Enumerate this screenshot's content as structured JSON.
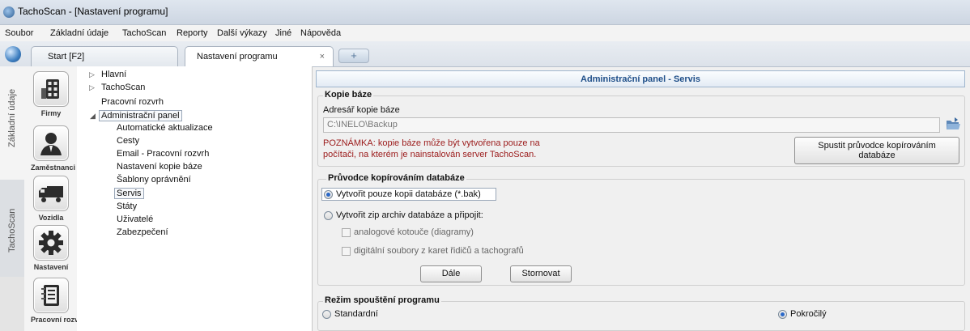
{
  "window": {
    "title": "TachoScan - [Nastavení programu]"
  },
  "menu": [
    "Soubor",
    "Základní údaje",
    "TachoScan",
    "Reporty",
    "Další výkazy",
    "Jiné",
    "Nápověda"
  ],
  "tabs": [
    {
      "label": "Start [F2]"
    },
    {
      "label": "Nastavení programu",
      "close": "×"
    }
  ],
  "new_tab": "+",
  "side_tabs": [
    "Základní údaje",
    "TachoScan"
  ],
  "icon_buttons": [
    {
      "label": "Firmy",
      "icon": "building-icon"
    },
    {
      "label": "Zaměstnanci",
      "icon": "employee-icon"
    },
    {
      "label": "Vozidla",
      "icon": "truck-icon"
    },
    {
      "label": "Nastavení",
      "icon": "gear-icon"
    },
    {
      "label": "Pracovní rozv...",
      "icon": "notebook-icon"
    }
  ],
  "tree": {
    "hlavni": "Hlavní",
    "tachoscan": "TachoScan",
    "pracovni_rozvrh": "Pracovní rozvrh",
    "admin": "Administrační panel",
    "children": [
      "Automatické aktualizace",
      "Cesty",
      "Email - Pracovní rozvrh",
      "Nastavení kopie báze",
      "Šablony oprávnění",
      "Servis",
      "Státy",
      "Uživatelé",
      "Zabezpečení"
    ]
  },
  "panel": {
    "header": "Administrační panel - Servis",
    "kopie": {
      "title": "Kopie báze",
      "dir_label": "Adresář kopie báze",
      "dir_value": "C:\\INELO\\Backup",
      "note_line1": "POZNÁMKA: kopie báze může být vytvořena pouze na",
      "note_line2": "počítači, na kterém je nainstalován server TachoScan.",
      "wizard_btn_line1": "Spustit průvodce kopírováním",
      "wizard_btn_line2": "databáze"
    },
    "pruvodce": {
      "title": "Průvodce kopírováním databáze",
      "opt1": "Vytvořit pouze kopii databáze (*.bak)",
      "opt2": "Vytvořit zip archiv databáze a připojit:",
      "chk1": "analogové kotouče (diagramy)",
      "chk2": "digitální soubory z karet řidičů a tachografů",
      "next": "Dále",
      "cancel": "Stornovat"
    },
    "rezim": {
      "title": "Režim spouštění programu",
      "std": "Standardní",
      "adv": "Pokročilý"
    }
  },
  "colors": {
    "accent": "#1f4f89",
    "note": "#9b1a1a",
    "radio": "#2a68c8"
  }
}
